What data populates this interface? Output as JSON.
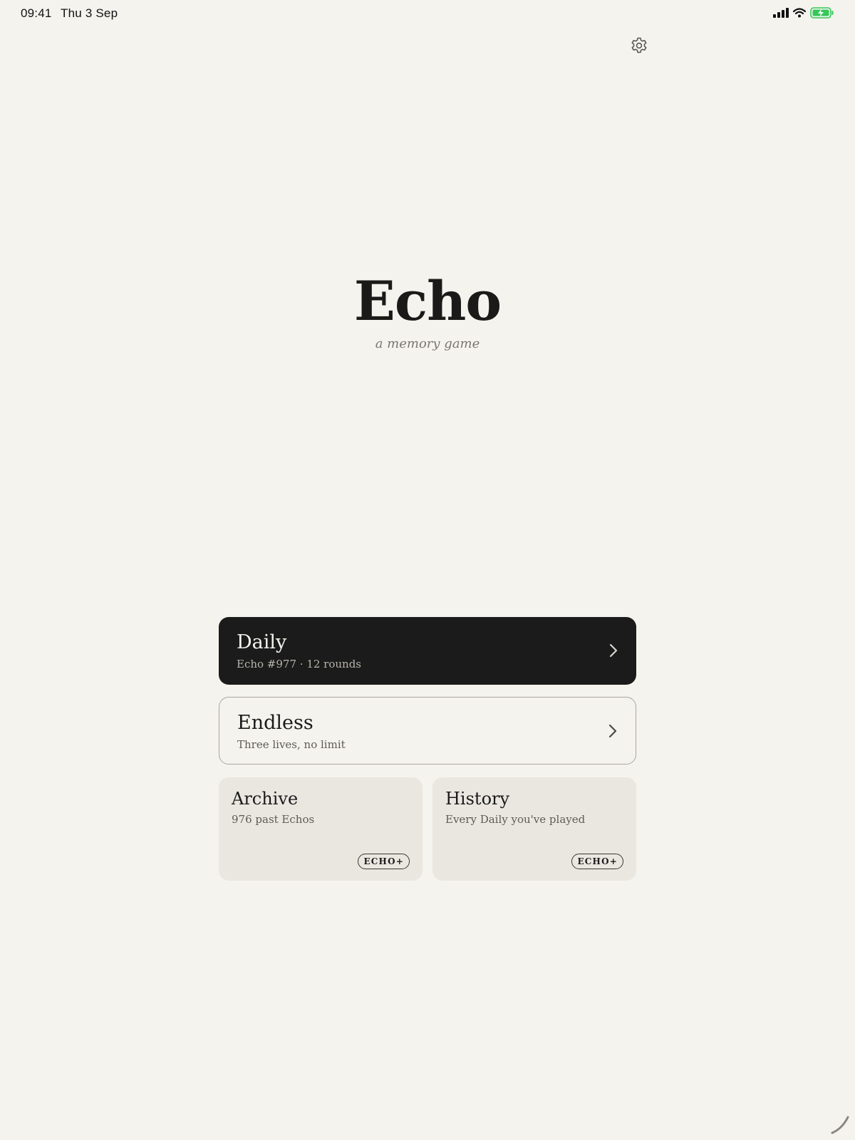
{
  "status_bar": {
    "time": "09:41",
    "date": "Thu 3 Sep",
    "icons": [
      "cellular-signal-icon",
      "wifi-icon",
      "battery-charging-icon"
    ],
    "battery_color": "#34c759"
  },
  "header": {
    "settings_icon": "gear-icon"
  },
  "hero": {
    "title": "Echo",
    "subtitle": "a memory game"
  },
  "modes": {
    "daily": {
      "title": "Daily",
      "subtitle": "Echo #977 · 12 rounds",
      "icon": "chevron-right-icon"
    },
    "endless": {
      "title": "Endless",
      "subtitle": "Three lives, no limit",
      "icon": "chevron-right-icon"
    }
  },
  "tiles": {
    "archive": {
      "title": "Archive",
      "subtitle": "976 past Echos",
      "badge": "ECHO+"
    },
    "history": {
      "title": "History",
      "subtitle": "Every Daily you've played",
      "badge": "ECHO+"
    }
  },
  "theme": {
    "background": "#f5f3ee",
    "primary_dark": "#1b1b1b",
    "tile_background": "#eae7e1"
  }
}
